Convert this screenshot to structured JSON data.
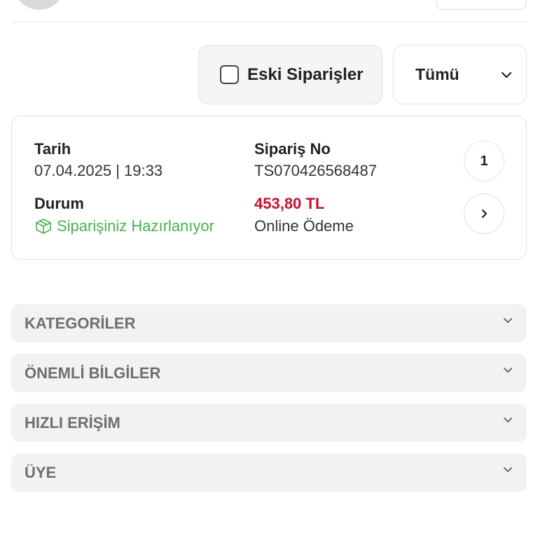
{
  "filters": {
    "old_orders_label": "Eski Siparişler",
    "old_orders_checked": false,
    "select_value": "Tümü"
  },
  "order": {
    "date_label": "Tarih",
    "date_value": "07.04.2025 | 19:33",
    "order_no_label": "Sipariş No",
    "order_no_value": "TS070426568487",
    "status_label": "Durum",
    "status_value": "Siparişiniz Hazırlanıyor",
    "price": "453,80 TL",
    "payment": "Online Ödeme",
    "item_count": "1"
  },
  "accordions": [
    {
      "title": "KATEGORİLER"
    },
    {
      "title": "ÖNEMLİ BİLGİLER"
    },
    {
      "title": "HIZLI ERİŞİM"
    },
    {
      "title": "ÜYE"
    }
  ],
  "colors": {
    "price": "#c8102e",
    "status": "#4caf50",
    "accordion_bg": "#f2f2f2"
  },
  "icons": {
    "status": "package-icon",
    "order_detail": "chevron-right-icon",
    "select": "chevron-down-icon"
  }
}
